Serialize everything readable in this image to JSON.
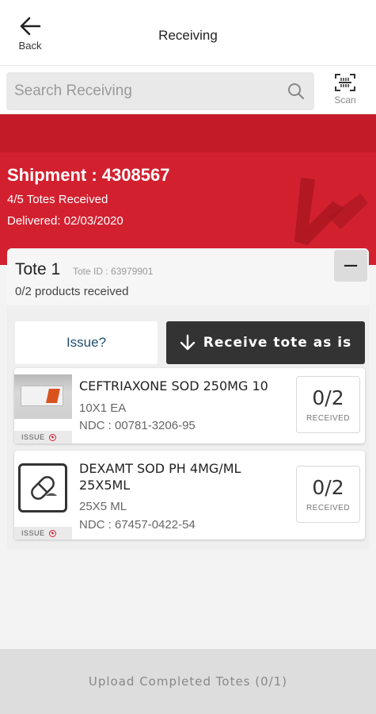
{
  "header": {
    "back_label": "Back",
    "title": "Receiving"
  },
  "search": {
    "placeholder": "Search Receiving",
    "value": "",
    "scan_label": "Scan"
  },
  "shipment": {
    "title": "Shipment : 4308567",
    "totes_received": "4/5 Totes Received",
    "delivered": "Delivered: 02/03/2020"
  },
  "tote": {
    "name": "Tote 1",
    "tote_id": "Tote ID : 63979901",
    "progress": "0/2 products received",
    "collapse_symbol": "−",
    "issue_label": "Issue?",
    "receive_label": "Receive tote as is"
  },
  "products": [
    {
      "name": "CEFTRIAXONE SOD 250MG 10",
      "pack": "10X1 EA",
      "ndc": "NDC : 00781-3206-95",
      "count": "0/2",
      "count_label": "RECEIVED",
      "issue_label": "ISSUE",
      "thumb_icon": "product-photo"
    },
    {
      "name": "DEXAMT SOD PH 4MG/ML 25X5ML",
      "pack": "25X5 ML",
      "ndc": "NDC : 67457-0422-54",
      "count": "0/2",
      "count_label": "RECEIVED",
      "issue_label": "ISSUE",
      "thumb_icon": "pill-placeholder-icon"
    }
  ],
  "footer": {
    "upload_label": "Upload Completed Totes (0/1)"
  },
  "colors": {
    "brand_red": "#d2202f",
    "dark_button": "#333333",
    "issue_text": "#1f4d6e"
  }
}
